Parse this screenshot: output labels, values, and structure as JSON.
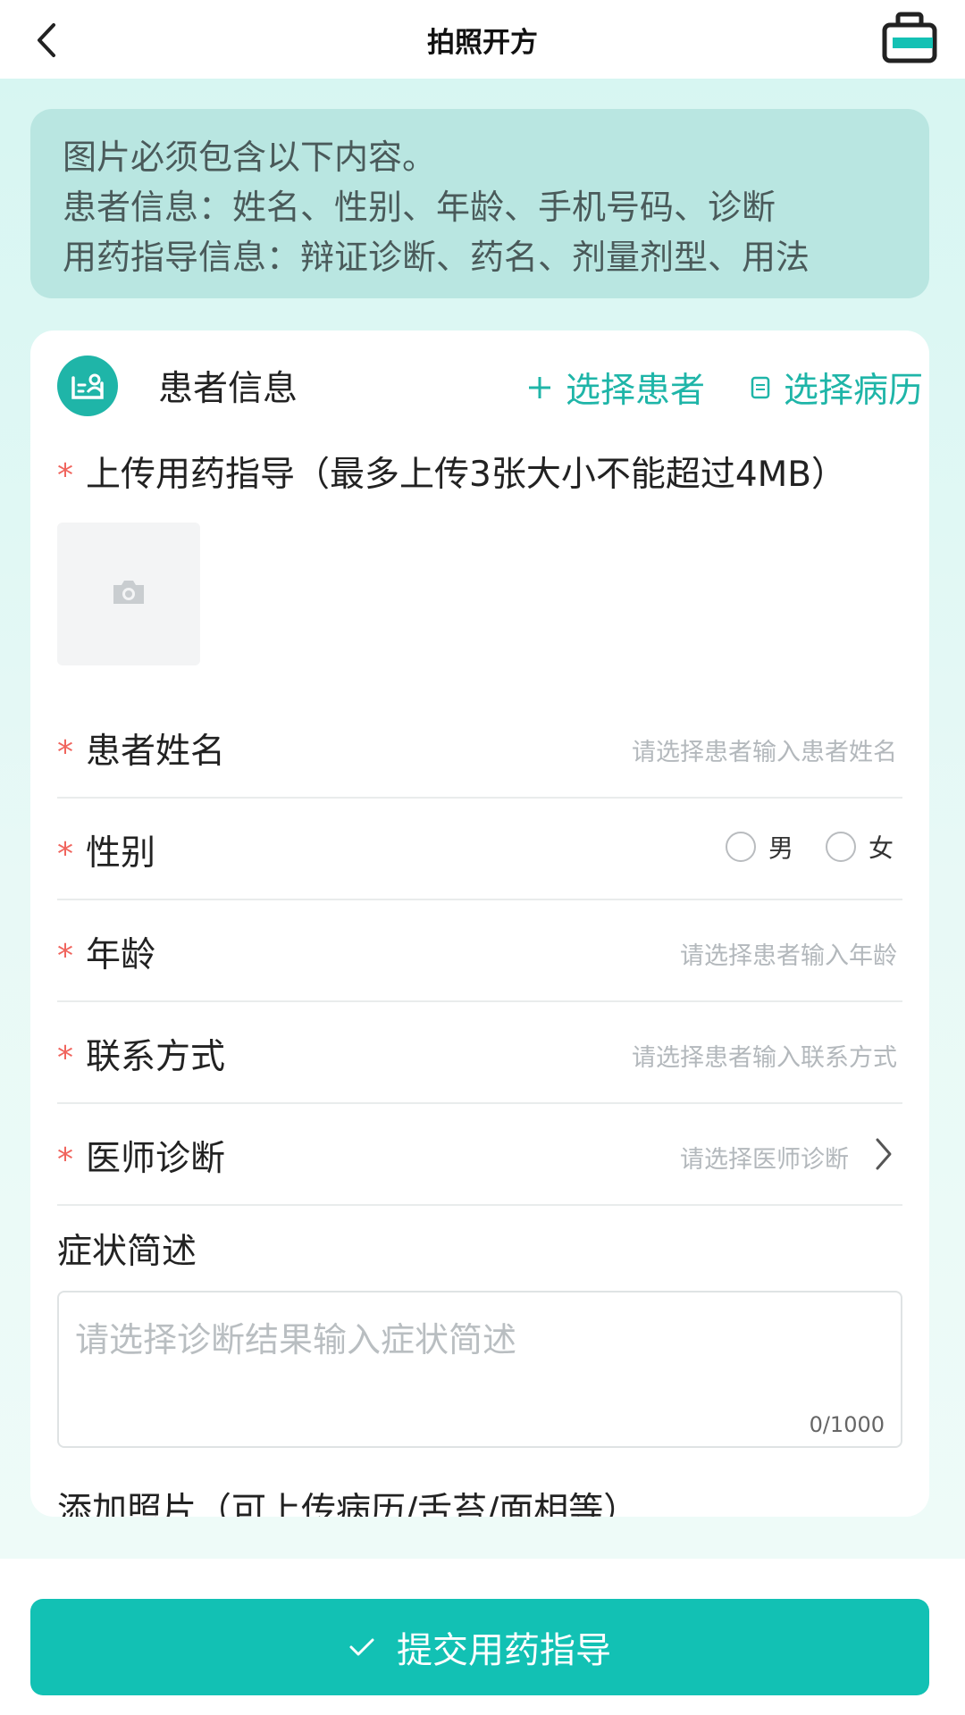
{
  "nav": {
    "title": "拍照开方",
    "back_icon": "chevron-left-icon",
    "cart_icon": "medicine-box-icon"
  },
  "notice": {
    "lines": [
      "图片必须包含以下内容。",
      "患者信息：姓名、性别、年龄、手机号码、诊断",
      "用药指导信息：辩证诊断、药名、剂量剂型、用法"
    ]
  },
  "patient_section": {
    "title": "患者信息",
    "select_patient": "选择患者",
    "select_record": "选择病历"
  },
  "upload": {
    "label": "上传用药指导（最多上传3张大小不能超过4MB）"
  },
  "fields": {
    "name": {
      "label": "患者姓名",
      "placeholder": "请选择患者输入患者姓名"
    },
    "gender": {
      "label": "性别",
      "options": [
        "男",
        "女"
      ]
    },
    "age": {
      "label": "年龄",
      "placeholder": "请选择患者输入年龄"
    },
    "contact": {
      "label": "联系方式",
      "placeholder": "请选择患者输入联系方式"
    },
    "diagnosis": {
      "label": "医师诊断",
      "placeholder": "请选择医师诊断"
    }
  },
  "symptom": {
    "title": "症状简述",
    "placeholder": "请选择诊断结果输入症状简述",
    "counter": "0/1000"
  },
  "more_photos": {
    "title": "添加照片（可上传病历/舌苔/面相等）"
  },
  "submit": {
    "label": "提交用药指导"
  },
  "colors": {
    "accent": "#12c1b4",
    "required_star": "#f0655e"
  }
}
